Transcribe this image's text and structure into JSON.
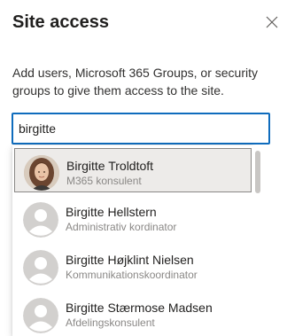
{
  "panel": {
    "title": "Site access",
    "description": "Add users, Microsoft 365 Groups, or security groups to give them access to the site.",
    "close_icon": "close-icon"
  },
  "search": {
    "value": "birgitte"
  },
  "suggestions": [
    {
      "name": "Birgitte Troldtoft",
      "subtitle": "M365 konsulent",
      "avatar": "photo"
    },
    {
      "name": "Birgitte Hellstern",
      "subtitle": "Administrativ kordinator",
      "avatar": "person-placeholder-icon"
    },
    {
      "name": "Birgitte Højklint Nielsen",
      "subtitle": "Kommunikationskoordinator",
      "avatar": "person-placeholder-icon"
    },
    {
      "name": "Birgitte Stærmose Madsen",
      "subtitle": "Afdelingskonsulent",
      "avatar": "person-placeholder-icon"
    }
  ],
  "colors": {
    "accent": "#0f6cbd",
    "selected_bg": "#edebe9",
    "placeholder_avatar": "#d2d0ce"
  }
}
